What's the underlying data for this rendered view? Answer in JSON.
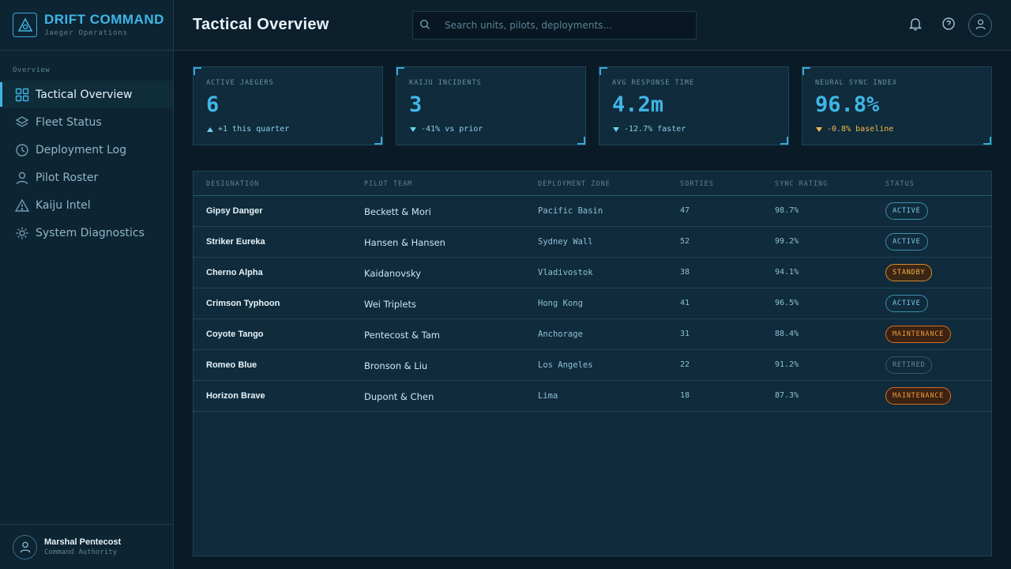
{
  "brand": {
    "title": "DRIFT COMMAND",
    "subtitle": "Jaeger Operations"
  },
  "sidebar": {
    "section": "Overview",
    "items": [
      {
        "label": "Tactical Overview",
        "icon": "grid-icon",
        "active": true
      },
      {
        "label": "Fleet Status",
        "icon": "layers-icon"
      },
      {
        "label": "Deployment Log",
        "icon": "clock-icon"
      },
      {
        "label": "Pilot Roster",
        "icon": "user-icon"
      },
      {
        "label": "Kaiju Intel",
        "icon": "warning-icon"
      },
      {
        "label": "System Diagnostics",
        "icon": "gear-icon"
      }
    ],
    "user": {
      "name": "Marshal Pentecost",
      "role": "Command Authority"
    }
  },
  "header": {
    "title": "Tactical Overview",
    "search_placeholder": "Search units, pilots, deployments..."
  },
  "stats": [
    {
      "label": "ACTIVE JAEGERS",
      "value": "6",
      "delta": "+1 this quarter",
      "trend": "up"
    },
    {
      "label": "KAIJU INCIDENTS",
      "value": "3",
      "delta": "-41% vs prior",
      "trend": "down"
    },
    {
      "label": "AVG RESPONSE TIME",
      "value": "4.2m",
      "delta": "-12.7% faster",
      "trend": "down"
    },
    {
      "label": "NEURAL SYNC INDEX",
      "value": "96.8%",
      "delta": "-0.8% baseline",
      "trend": "down-warn"
    }
  ],
  "table": {
    "columns": [
      "DESIGNATION",
      "PILOT TEAM",
      "DEPLOYMENT ZONE",
      "SORTIES",
      "SYNC RATING",
      "STATUS"
    ],
    "rows": [
      {
        "designation": "Gipsy Danger",
        "team": "Beckett & Mori",
        "zone": "Pacific Basin",
        "sorties": "47",
        "sync": "98.7%",
        "status": "ACTIVE",
        "status_kind": "active"
      },
      {
        "designation": "Striker Eureka",
        "team": "Hansen & Hansen",
        "zone": "Sydney Wall",
        "sorties": "52",
        "sync": "99.2%",
        "status": "ACTIVE",
        "status_kind": "active"
      },
      {
        "designation": "Cherno Alpha",
        "team": "Kaidanovsky",
        "zone": "Vladivostok",
        "sorties": "38",
        "sync": "94.1%",
        "status": "STANDBY",
        "status_kind": "standby"
      },
      {
        "designation": "Crimson Typhoon",
        "team": "Wei Triplets",
        "zone": "Hong Kong",
        "sorties": "41",
        "sync": "96.5%",
        "status": "ACTIVE",
        "status_kind": "active"
      },
      {
        "designation": "Coyote Tango",
        "team": "Pentecost & Tam",
        "zone": "Anchorage",
        "sorties": "31",
        "sync": "88.4%",
        "status": "MAINTENANCE",
        "status_kind": "maintenance"
      },
      {
        "designation": "Romeo Blue",
        "team": "Bronson & Liu",
        "zone": "Los Angeles",
        "sorties": "22",
        "sync": "91.2%",
        "status": "RETIRED",
        "status_kind": "retired"
      },
      {
        "designation": "Horizon Brave",
        "team": "Dupont & Chen",
        "zone": "Lima",
        "sorties": "18",
        "sync": "87.3%",
        "status": "MAINTENANCE",
        "status_kind": "maintenance"
      }
    ]
  }
}
